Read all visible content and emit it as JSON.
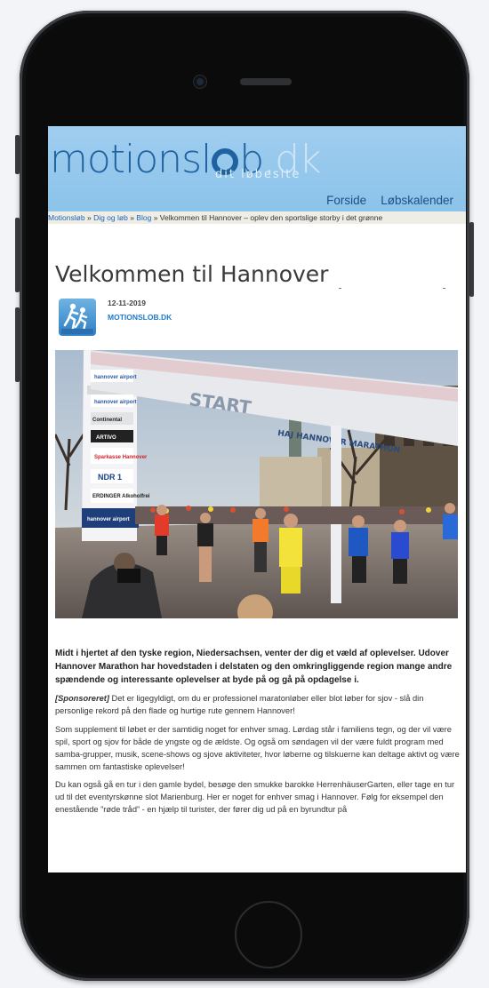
{
  "site": {
    "logo_part1": "motionsl",
    "logo_part2": "b",
    "logo_dk": ".dk",
    "tagline": "dit løbesite",
    "nav": [
      "Forside",
      "Løbskalender"
    ]
  },
  "breadcrumb": {
    "items": [
      "Motionsløb",
      "Dig og løb",
      "Blog"
    ],
    "separator": "»",
    "current": "Velkommen til Hannover – oplev den sportslige storby i det grønne"
  },
  "article": {
    "title": "Velkommen til Hannover",
    "date": "12-11-2019",
    "author": "MOTIONSLOB.DK",
    "lead": "Midt i hjertet af den tyske region, Niedersachsen, venter der dig et væld af oplevelser. Udover Hannover Marathon har hovedstaden i delstaten og den omkringliggende region mange andre spændende og interessante oplevelser at byde på og gå på opdagelse i.",
    "sponsor_label": "[Sponsoreret]",
    "sponsor_text": " Det er ligegyldigt, om du er professionel maratonløber eller blot løber for sjov - slå din personlige rekord på den flade og hurtige rute gennem Hannover!",
    "paragraphs": [
      "Som supplement til løbet er der samtidig noget for enhver smag. Lørdag står i familiens tegn, og der vil være spil, sport og sjov for både de yngste og de ældste. Og også om søndagen vil der være fuldt program med samba-grupper, musik, scene-shows og sjove aktiviteter, hvor løberne og tilskuerne kan deltage aktivt og være sammen om fantastiske oplevelser!",
      "Du kan også gå en tur i den gamle bydel, besøge den smukke barokke HerrenhäuserGarten, eller tage en tur ud til det eventyrskønne slot Marienburg. Her er noget for enhver smag i Hannover. Følg for eksempel den enestående ”røde tråd” - en hjælp til turister, der fører dig ud på en byrundtur på"
    ]
  },
  "hero": {
    "arch_text": "START",
    "banner_text": "HAJ HANNOVER MARATHON",
    "sponsors": [
      "hannover airport",
      "hannover airport",
      "Continental",
      "ARTIVO",
      "Sparkasse Hannover",
      "NDR 1",
      "ERDINGER Alkoholfrei",
      "hannover airport"
    ]
  },
  "colors": {
    "header_bg": "#9fcdef",
    "link": "#1f63b6",
    "logo": "#1e62a0"
  }
}
